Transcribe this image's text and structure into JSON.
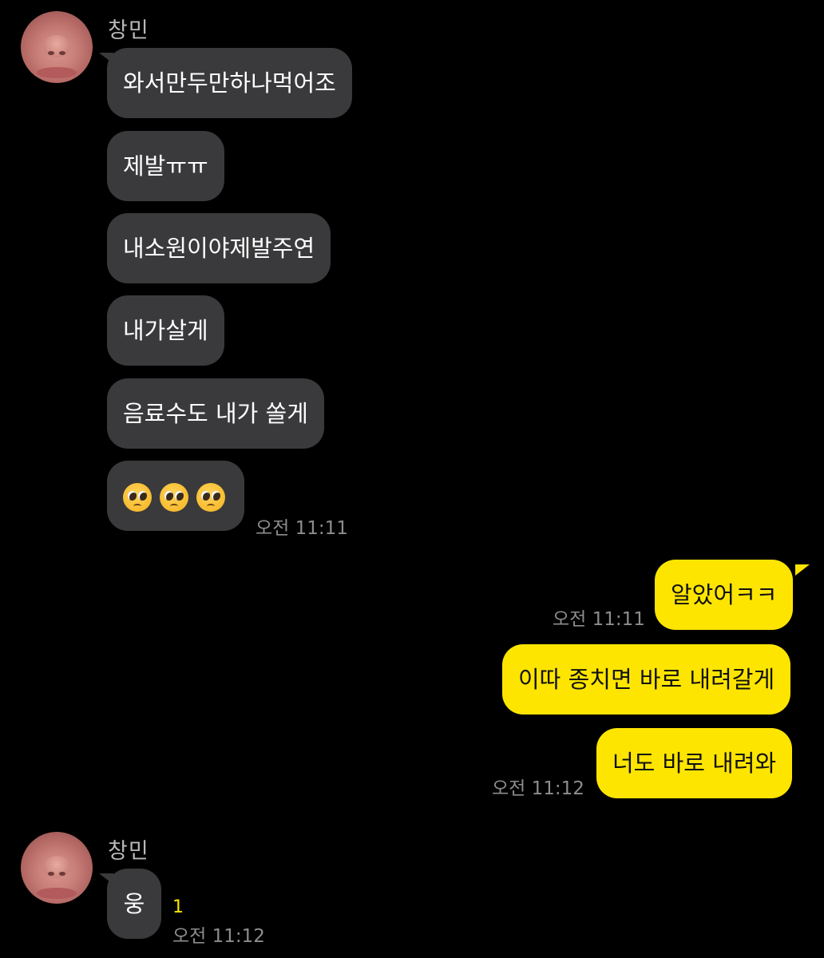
{
  "chat": {
    "contact_name": "창민",
    "groups": [
      {
        "sender": "창민",
        "messages": [
          "와서만두만하나먹어조",
          "제발ㅠㅠ",
          "내소원이야제발주연",
          "내가살게",
          "음료수도 내가 쏠게"
        ],
        "emoji_message": [
          "pleading-face",
          "pleading-face",
          "pleading-face"
        ],
        "time": "오전 11:11"
      },
      {
        "sender": "me",
        "messages": [
          {
            "text": "알았어ㅋㅋ",
            "time": "오전 11:11"
          },
          {
            "text": "이따 종치면 바로 내려갈게"
          },
          {
            "text": "너도 바로 내려와",
            "time": "오전 11:12"
          }
        ]
      },
      {
        "sender": "창민",
        "messages": [
          "웅"
        ],
        "unread_count": "1",
        "time": "오전 11:12"
      }
    ]
  },
  "colors": {
    "background": "#000000",
    "incoming_bubble": "#3a3a3c",
    "outgoing_bubble": "#fee500",
    "timestamp": "#8d8d8d",
    "unread": "#fee500"
  }
}
